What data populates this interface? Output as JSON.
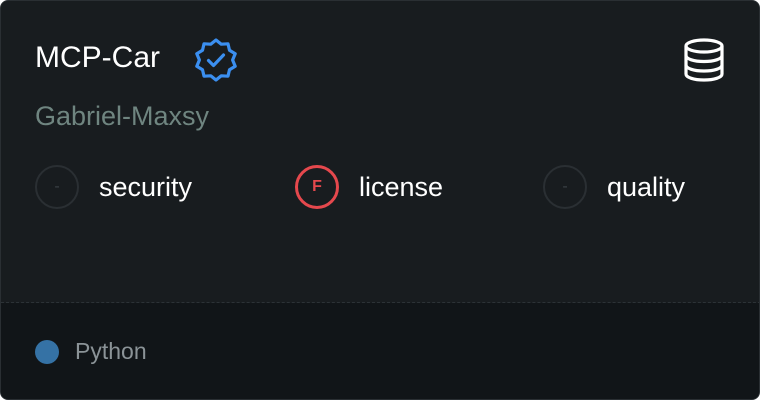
{
  "card": {
    "title": "MCP-Car",
    "verified_icon": "verified-badge-icon",
    "type_icon": "database-icon",
    "author": "Gabriel-Maxsy"
  },
  "metrics": [
    {
      "label": "security",
      "grade": "-"
    },
    {
      "label": "license",
      "grade": "F"
    },
    {
      "label": "quality",
      "grade": "-"
    }
  ],
  "footer": {
    "language": "Python",
    "language_color": "#3572A5"
  },
  "colors": {
    "card_background": "#181c1f",
    "footer_background": "#111518",
    "verified": "#3b8ff0",
    "grade_f": "#e5484d",
    "author_text": "#6f8580"
  }
}
